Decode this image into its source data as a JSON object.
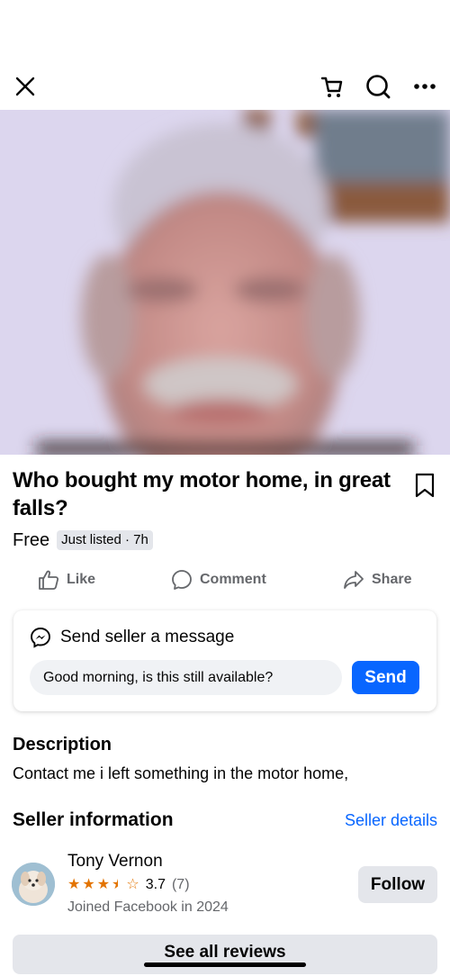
{
  "header": {
    "close_icon": "close-icon",
    "cart_icon": "cart-icon",
    "search_icon": "search-icon",
    "more_icon": "more-icon"
  },
  "listing": {
    "title": "Who bought my motor home, in great falls?",
    "price": "Free",
    "badge": "Just listed · 7h"
  },
  "actions": {
    "like": "Like",
    "comment": "Comment",
    "share": "Share"
  },
  "message_card": {
    "heading": "Send seller a message",
    "input_value": "Good morning, is this still available?",
    "send_label": "Send"
  },
  "description": {
    "heading": "Description",
    "text": "Contact me i left something in the motor home,"
  },
  "seller": {
    "heading": "Seller information",
    "details_link": "Seller details",
    "name": "Tony Vernon",
    "rating_value": "3.7",
    "rating_count": "(7)",
    "rating_stars": 3.5,
    "joined": "Joined Facebook in 2024",
    "follow_label": "Follow"
  },
  "reviews_button": "See all reviews",
  "colors": {
    "accent": "#0866ff",
    "star": "#e37400",
    "secondary_text": "#65676b",
    "button_gray": "#e4e6eb"
  }
}
